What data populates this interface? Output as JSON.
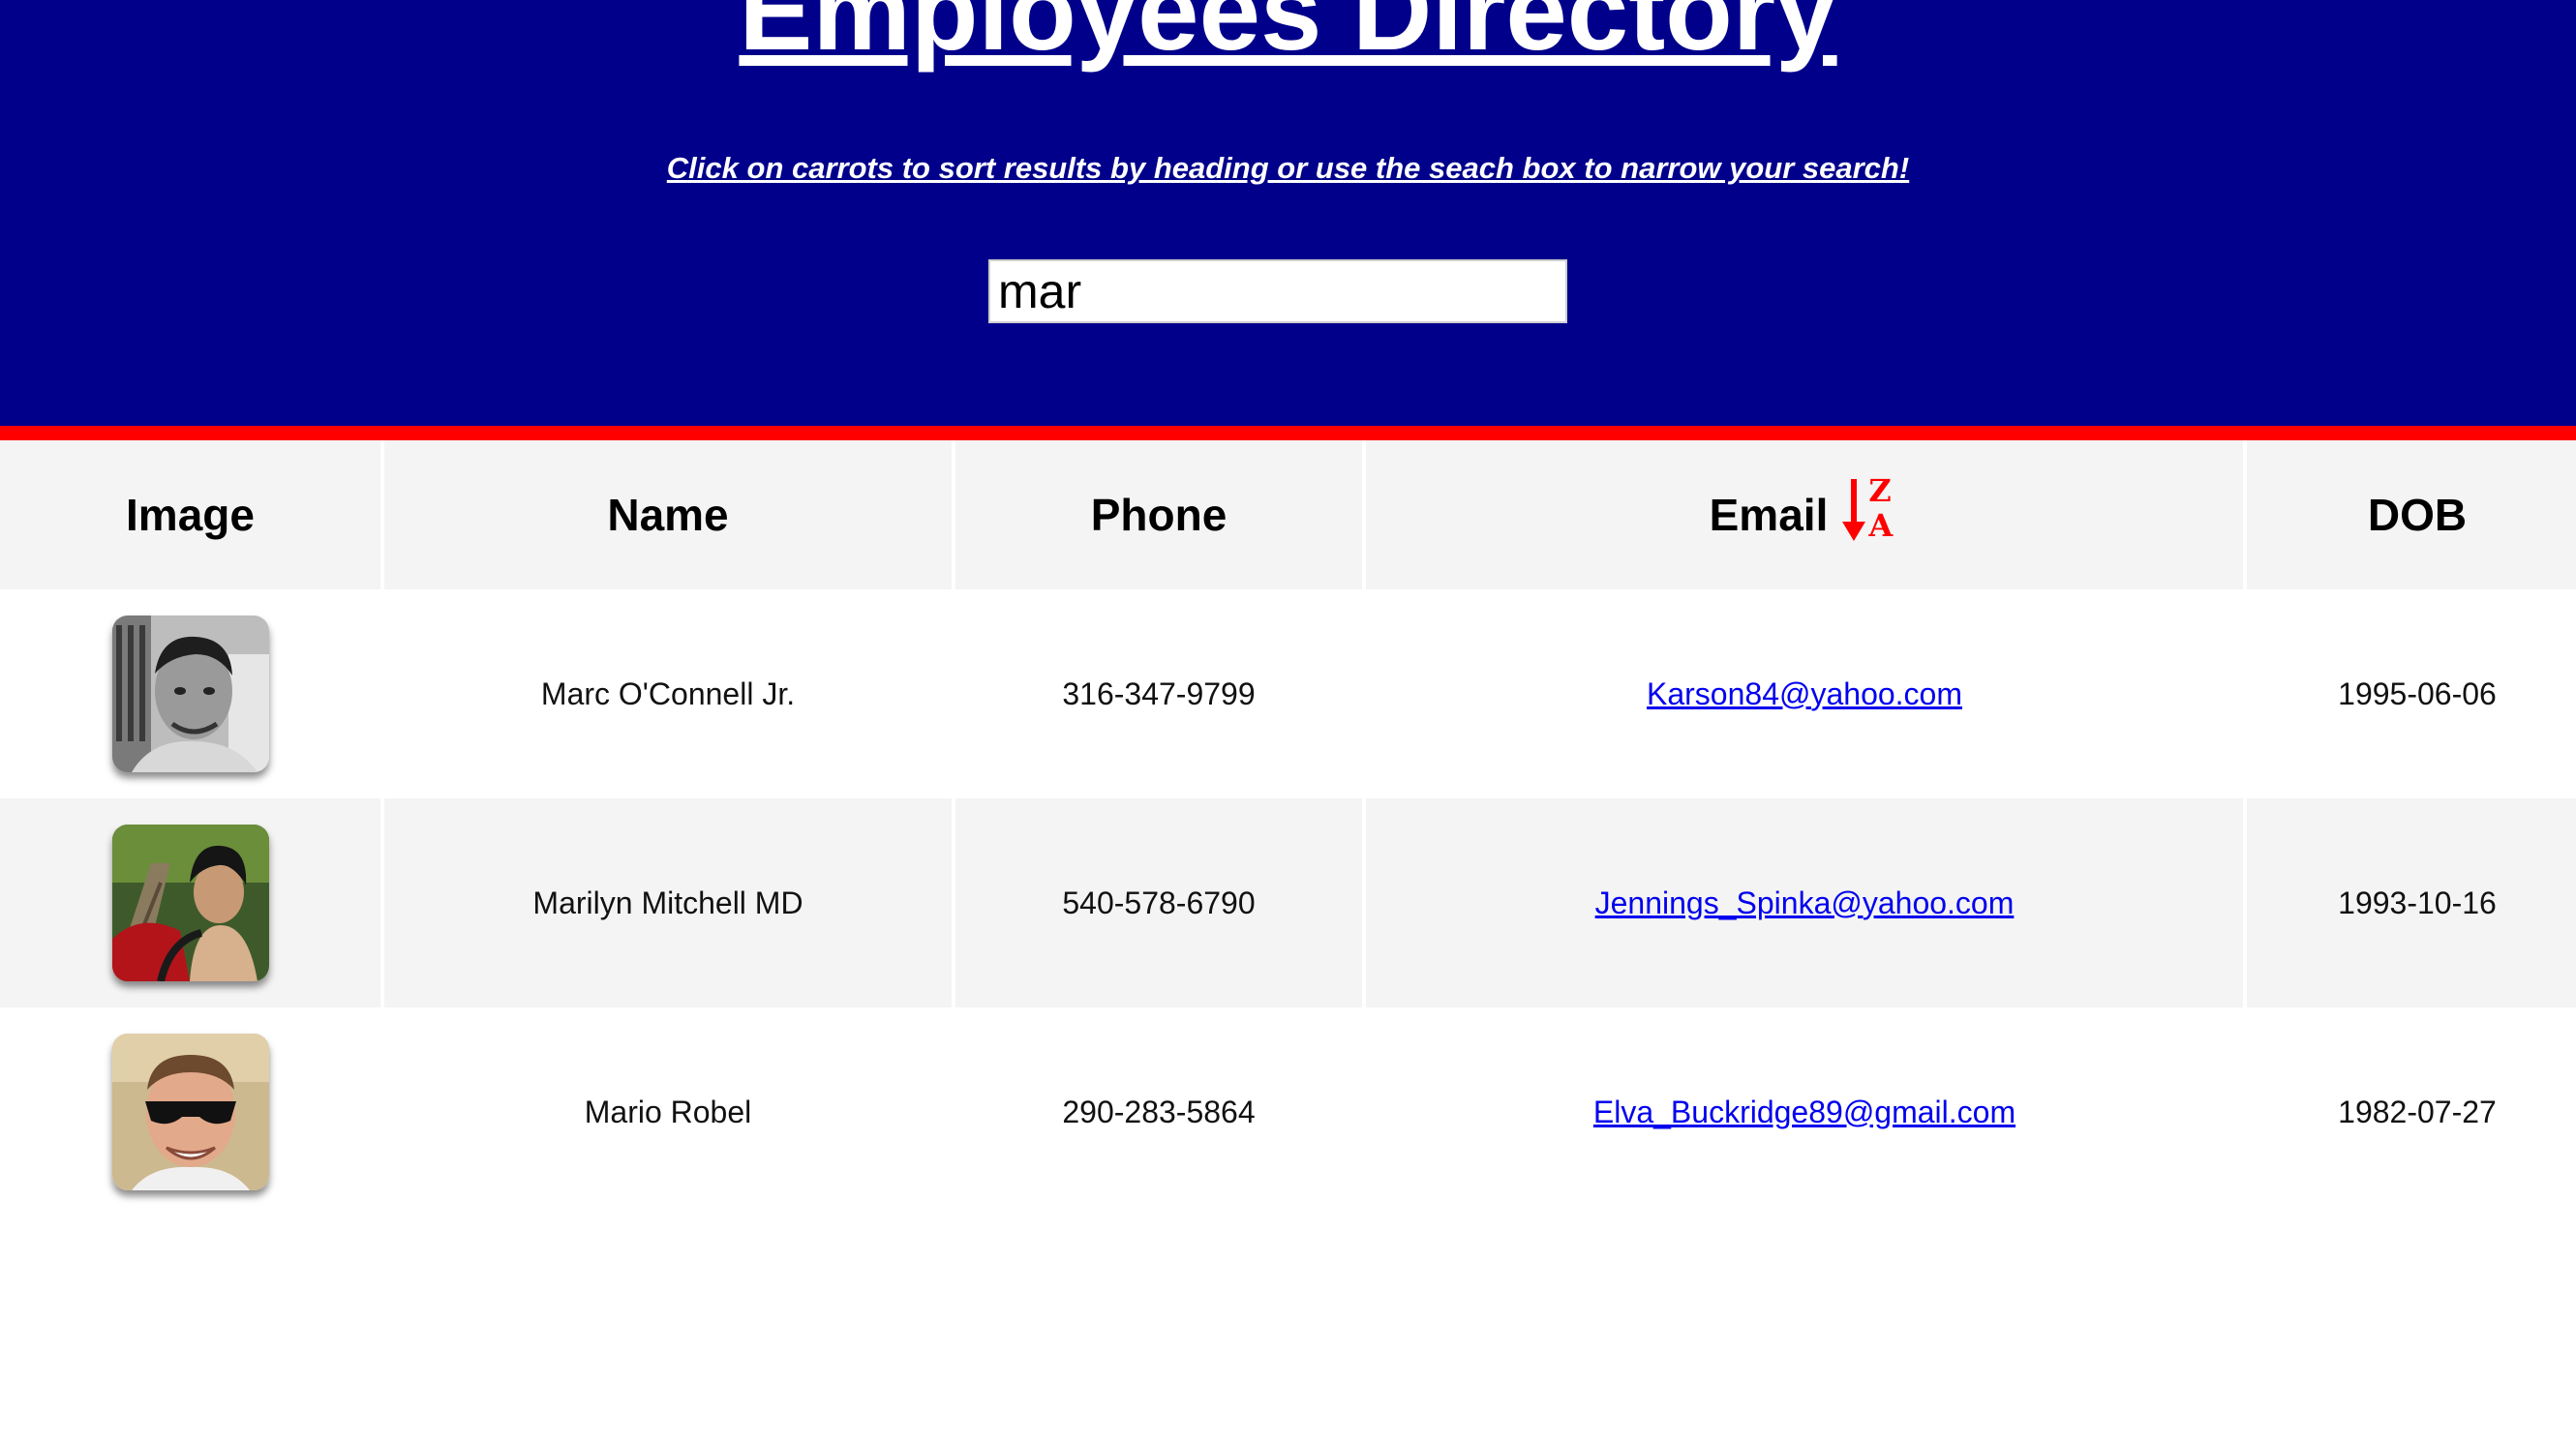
{
  "header": {
    "title": "Employees Directory",
    "subtitle": "Click on carrots to sort results by heading or use the seach box to narrow your search!",
    "search_value": "mar"
  },
  "table": {
    "columns": [
      "Image",
      "Name",
      "Phone",
      "Email",
      "DOB"
    ],
    "sort": {
      "column": "Email",
      "icon": "sort-z-to-a-icon",
      "top_letter": "Z",
      "bottom_letter": "A",
      "color": "#ff0000"
    },
    "rows": [
      {
        "avatar": "employee-photo",
        "name": "Marc O'Connell Jr.",
        "phone": "316-347-9799",
        "email": "Karson84@yahoo.com",
        "dob": "1995-06-06"
      },
      {
        "avatar": "employee-photo",
        "name": "Marilyn Mitchell MD",
        "phone": "540-578-6790",
        "email": "Jennings_Spinka@yahoo.com",
        "dob": "1993-10-16"
      },
      {
        "avatar": "employee-photo",
        "name": "Mario Robel",
        "phone": "290-283-5864",
        "email": "Elva_Buckridge89@gmail.com",
        "dob": "1982-07-27"
      }
    ]
  },
  "colors": {
    "header_bg": "#00008b",
    "header_border": "#ff0000",
    "link": "#0000ee"
  }
}
